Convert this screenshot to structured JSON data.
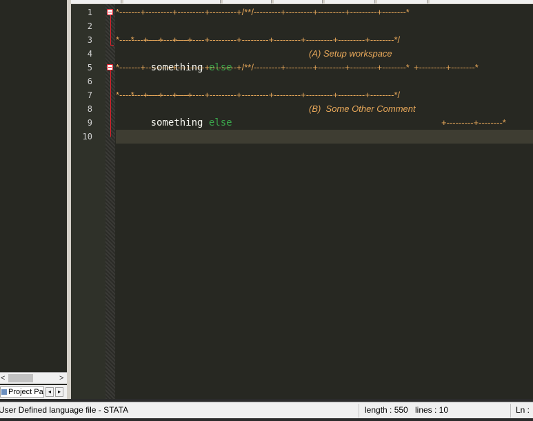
{
  "line_numbers": [
    "1",
    "2",
    "3",
    "4",
    "5",
    "6",
    "7",
    "8",
    "9",
    "10"
  ],
  "code_lines": [
    {
      "text": "*-------+---------+---------+---------+/**/---------+---------+---------+---------+--------*"
    },
    {
      "left": "*--------+--------+",
      "label": "(A) Setup workspace",
      "right": "+---------+--------*"
    },
    {
      "text": "*--------+--------+---------+---------+---------+---------+---------+---------+--------*/"
    },
    {
      "word": "something",
      "kw": "else"
    },
    {
      "text": "*-------+---------+---------+---------+/**/---------+---------+---------+---------+--------*"
    },
    {
      "left": "*--------+--------+",
      "label": "(B)  Some Other Comment",
      "right": "+---------+--------*"
    },
    {
      "text": "*--------+--------+---------+---------+---------+---------+---------+---------+--------*/"
    },
    {
      "word": "something",
      "kw": "else"
    }
  ],
  "left_panel": {
    "tab_label": "Project Par",
    "scroll_left": "<",
    "scroll_right": ">",
    "nav_prev": "◂",
    "nav_next": "▸"
  },
  "statusbar": {
    "language": "User Defined language file - STATA",
    "length": "length : 550",
    "lines": "lines : 10",
    "ln": "Ln :"
  },
  "colors": {
    "editor_bg": "#272822",
    "comment": "#e8a85a",
    "keyword": "#3aa64b",
    "code_text": "#f8f8f2",
    "fold_marker": "#e0202a"
  }
}
